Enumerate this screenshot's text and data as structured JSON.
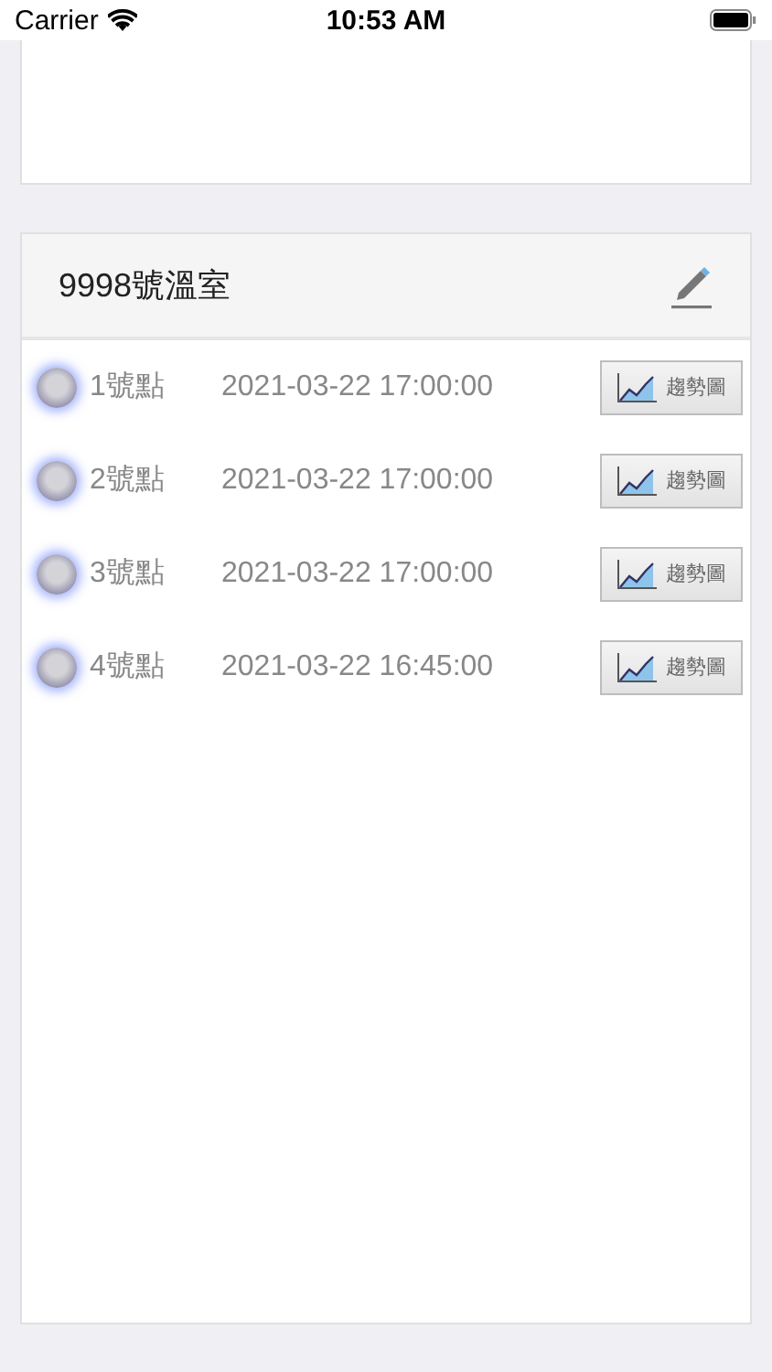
{
  "status_bar": {
    "carrier": "Carrier",
    "time": "10:53 AM"
  },
  "greenhouse": {
    "title": "9998號溫室",
    "points": [
      {
        "name": "1號點",
        "time": "2021-03-22 17:00:00",
        "button": "趨勢圖"
      },
      {
        "name": "2號點",
        "time": "2021-03-22 17:00:00",
        "button": "趨勢圖"
      },
      {
        "name": "3號點",
        "time": "2021-03-22 17:00:00",
        "button": "趨勢圖"
      },
      {
        "name": "4號點",
        "time": "2021-03-22 16:45:00",
        "button": "趨勢圖"
      }
    ]
  }
}
